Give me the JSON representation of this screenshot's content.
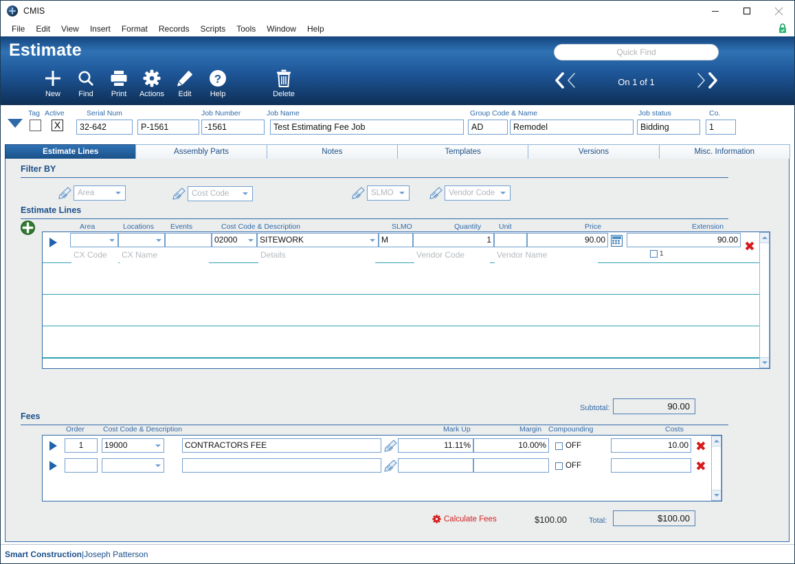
{
  "window": {
    "app_title": "CMIS",
    "app_icon": "globe-icon",
    "minimize": "minimize-icon",
    "maximize": "maximize-icon",
    "close": "close-icon",
    "lock": "lock-icon"
  },
  "menu": {
    "items": [
      "File",
      "Edit",
      "View",
      "Insert",
      "Format",
      "Records",
      "Scripts",
      "Tools",
      "Window",
      "Help"
    ]
  },
  "header": {
    "title": "Estimate",
    "toolbar": [
      {
        "label": "New",
        "icon": "plus-icon"
      },
      {
        "label": "Find",
        "icon": "magnifier-icon"
      },
      {
        "label": "Print",
        "icon": "printer-icon"
      },
      {
        "label": "Actions",
        "icon": "gear-icon"
      },
      {
        "label": "Edit",
        "icon": "pencil-icon"
      },
      {
        "label": "Help",
        "icon": "question-circle-icon"
      },
      {
        "label": "Delete",
        "icon": "trash-icon"
      }
    ],
    "quick_find_placeholder": "Quick Find",
    "record_position": "On 1 of 1",
    "nav_first": "first-record-icon",
    "nav_prev": "previous-record-icon",
    "nav_next": "next-record-icon",
    "nav_last": "last-record-icon"
  },
  "record_fields": {
    "expander": "collapse-triangle-icon",
    "tag_label": "Tag",
    "tag_checked": false,
    "active_label": "Active",
    "active_checked": true,
    "active_mark": "X",
    "serial_num_label": "Serial Num",
    "serial_num": "32-642",
    "serial_num_2": "P-1561",
    "job_number_label": "Job Number",
    "job_number": "-1561",
    "job_name_label": "Job Name",
    "job_name": "Test Estimating Fee Job",
    "group_code_label": "Group Code & Name",
    "group_code": "AD",
    "group_name": "Remodel",
    "job_status_label": "Job status",
    "job_status": "Bidding",
    "co_label": "Co.",
    "co": "1"
  },
  "tabs": [
    {
      "label": "Estimate Lines",
      "active": true
    },
    {
      "label": "Assembly Parts",
      "active": false
    },
    {
      "label": "Notes",
      "active": false
    },
    {
      "label": "Templates",
      "active": false
    },
    {
      "label": "Versions",
      "active": false
    },
    {
      "label": "Misc. Information",
      "active": false
    }
  ],
  "filter": {
    "title": "Filter BY",
    "controls": [
      {
        "placeholder": "Area",
        "value": ""
      },
      {
        "placeholder": "Cost Code",
        "value": ""
      },
      {
        "placeholder": "SLMO",
        "value": ""
      },
      {
        "placeholder": "Vendor Code",
        "value": ""
      }
    ]
  },
  "estimate_lines": {
    "title": "Estimate Lines",
    "add_icon": "add-line-icon",
    "columns": [
      "Area",
      "Locations",
      "Events",
      "Cost Code & Description",
      "SLMO",
      "Quantity",
      "Unit",
      "Price",
      "Extension"
    ],
    "row": {
      "area": "",
      "locations": "",
      "events": "",
      "cost_code": "02000",
      "description": "SITEWORK",
      "slmo": "M",
      "quantity": "1",
      "unit": "",
      "price": "90.00",
      "extension": "90.00",
      "calc_icon": "calculator-icon",
      "taxable_checked": false,
      "taxable_label": "1",
      "delete_icon": "delete-row-icon",
      "sub_placeholders": {
        "cx_code": "CX Code",
        "cx_name": "CX Name",
        "details": "Details",
        "vendor_code": "Vendor Code",
        "vendor_name": "Vendor Name"
      }
    },
    "subtotal_label": "Subtotal:",
    "subtotal_value": "90.00"
  },
  "fees": {
    "title": "Fees",
    "columns": [
      "Order",
      "Cost Code & Description",
      "Mark Up",
      "Margin",
      "Compounding",
      "Costs"
    ],
    "rows": [
      {
        "order": "1",
        "cost_code": "19000",
        "description": "CONTRACTORS FEE",
        "mark_up": "11.11%",
        "margin": "10.00%",
        "compounding_label": "OFF",
        "compounding_checked": false,
        "costs": "10.00",
        "delete_icon": "delete-row-icon"
      },
      {
        "order": "",
        "cost_code": "",
        "description": "",
        "mark_up": "",
        "margin": "",
        "compounding_label": "OFF",
        "compounding_checked": false,
        "costs": "",
        "delete_icon": "delete-row-icon"
      }
    ],
    "calculate_label": "Calculate Fees",
    "calculate_icon": "gear-red-icon",
    "calculated_amount": "$100.00",
    "total_label": "Total:",
    "total_value": "$100.00"
  },
  "status": {
    "company": "Smart Construction",
    "separator": " | ",
    "user": "Joseph Patterson"
  },
  "colors": {
    "brand_blue": "#1d5596",
    "accent_blue": "#2f6aa8",
    "danger_red": "#d51b1b",
    "grid_line": "#2fa0b4",
    "panel_bg": "#eceded"
  }
}
